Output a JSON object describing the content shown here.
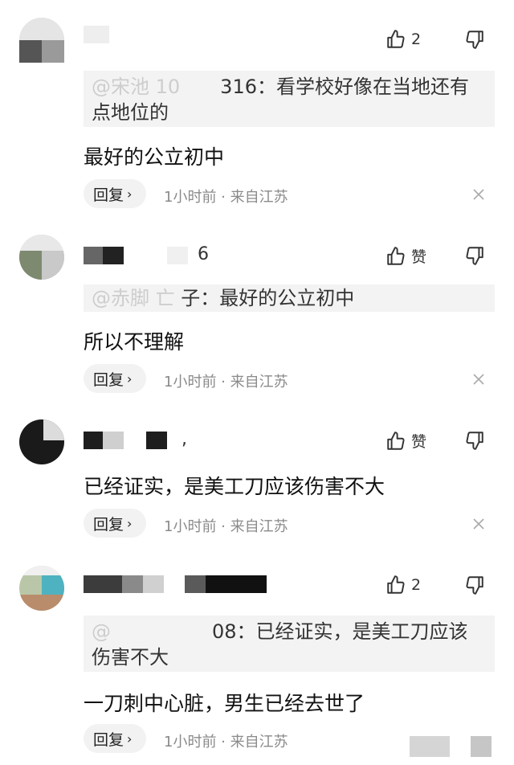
{
  "colors": {
    "background": "#ffffff",
    "meta_text": "#8a8a8a",
    "quote_bg": "#f3f3f3",
    "reply_bg": "#f2f2f2"
  },
  "comments": [
    {
      "like_label": "2",
      "quote_name": "@宋池 10",
      "quote_text": "316：看学校好像在当地还有点地位的",
      "text": "最好的公立初中",
      "reply_label": "回复",
      "meta": "1小时前 · 来自江苏"
    },
    {
      "name_suffix": "6",
      "like_label": "赞",
      "quote_name": "@赤脚 亡 ",
      "quote_text": "子：最好的公立初中",
      "text": "所以不理解",
      "reply_label": "回复",
      "meta": "1小时前 · 来自江苏"
    },
    {
      "name_suffix": ",",
      "like_label": "赞",
      "text": "已经证实，是美工刀应该伤害不大",
      "reply_label": "回复",
      "meta": "1小时前 · 来自江苏"
    },
    {
      "like_label": "2",
      "quote_name": "@",
      "quote_text": "08：已经证实，是美工刀应该伤害不大",
      "text": "一刀刺中心脏，男生已经去世了",
      "reply_label": "回复",
      "meta": "1小时前 · 来自江苏"
    }
  ]
}
